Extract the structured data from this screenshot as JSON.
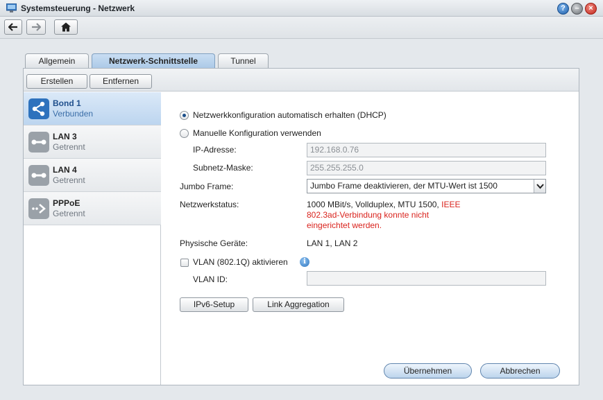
{
  "window": {
    "title": "Systemsteuerung - Netzwerk"
  },
  "window_buttons": {
    "help": "?",
    "minimize": "–",
    "close": "×"
  },
  "tabs": [
    {
      "label": "Allgemein"
    },
    {
      "label": "Netzwerk-Schnittstelle"
    },
    {
      "label": "Tunnel"
    }
  ],
  "actions": {
    "create": "Erstellen",
    "remove": "Entfernen"
  },
  "interfaces": [
    {
      "name": "Bond 1",
      "status": "Verbunden",
      "icon": "bond-share-icon"
    },
    {
      "name": "LAN 3",
      "status": "Getrennt",
      "icon": "lan-disconnected-icon"
    },
    {
      "name": "LAN 4",
      "status": "Getrennt",
      "icon": "lan-disconnected-icon"
    },
    {
      "name": "PPPoE",
      "status": "Getrennt",
      "icon": "pppoe-icon"
    }
  ],
  "form": {
    "dhcp_label": "Netzwerkkonfiguration automatisch erhalten (DHCP)",
    "manual_label": "Manuelle Konfiguration verwenden",
    "ip_label": "IP-Adresse:",
    "ip_value": "192.168.0.76",
    "mask_label": "Subnetz-Maske:",
    "mask_value": "255.255.255.0",
    "jumbo_label": "Jumbo Frame:",
    "jumbo_value": "Jumbo Frame deaktivieren, der MTU-Wert ist 1500",
    "status_label": "Netzwerkstatus:",
    "status_line1_black": "1000 MBit/s, Vollduplex, MTU 1500,",
    "status_line1_red": "IEEE",
    "status_line2": "802.3ad-Verbindung konnte nicht",
    "status_line3": "eingerichtet werden.",
    "devices_label": "Physische Geräte:",
    "devices_value": "LAN 1, LAN 2",
    "vlan_label": "VLAN (802.1Q) aktivieren",
    "vlan_id_label": "VLAN ID:",
    "vlan_id_value": "",
    "ipv6_button": "IPv6-Setup",
    "link_agg_button": "Link Aggregation",
    "apply_button": "Übernehmen",
    "cancel_button": "Abbrechen"
  },
  "colors": {
    "accent": "#1f4f8c",
    "error": "#d9231d"
  }
}
